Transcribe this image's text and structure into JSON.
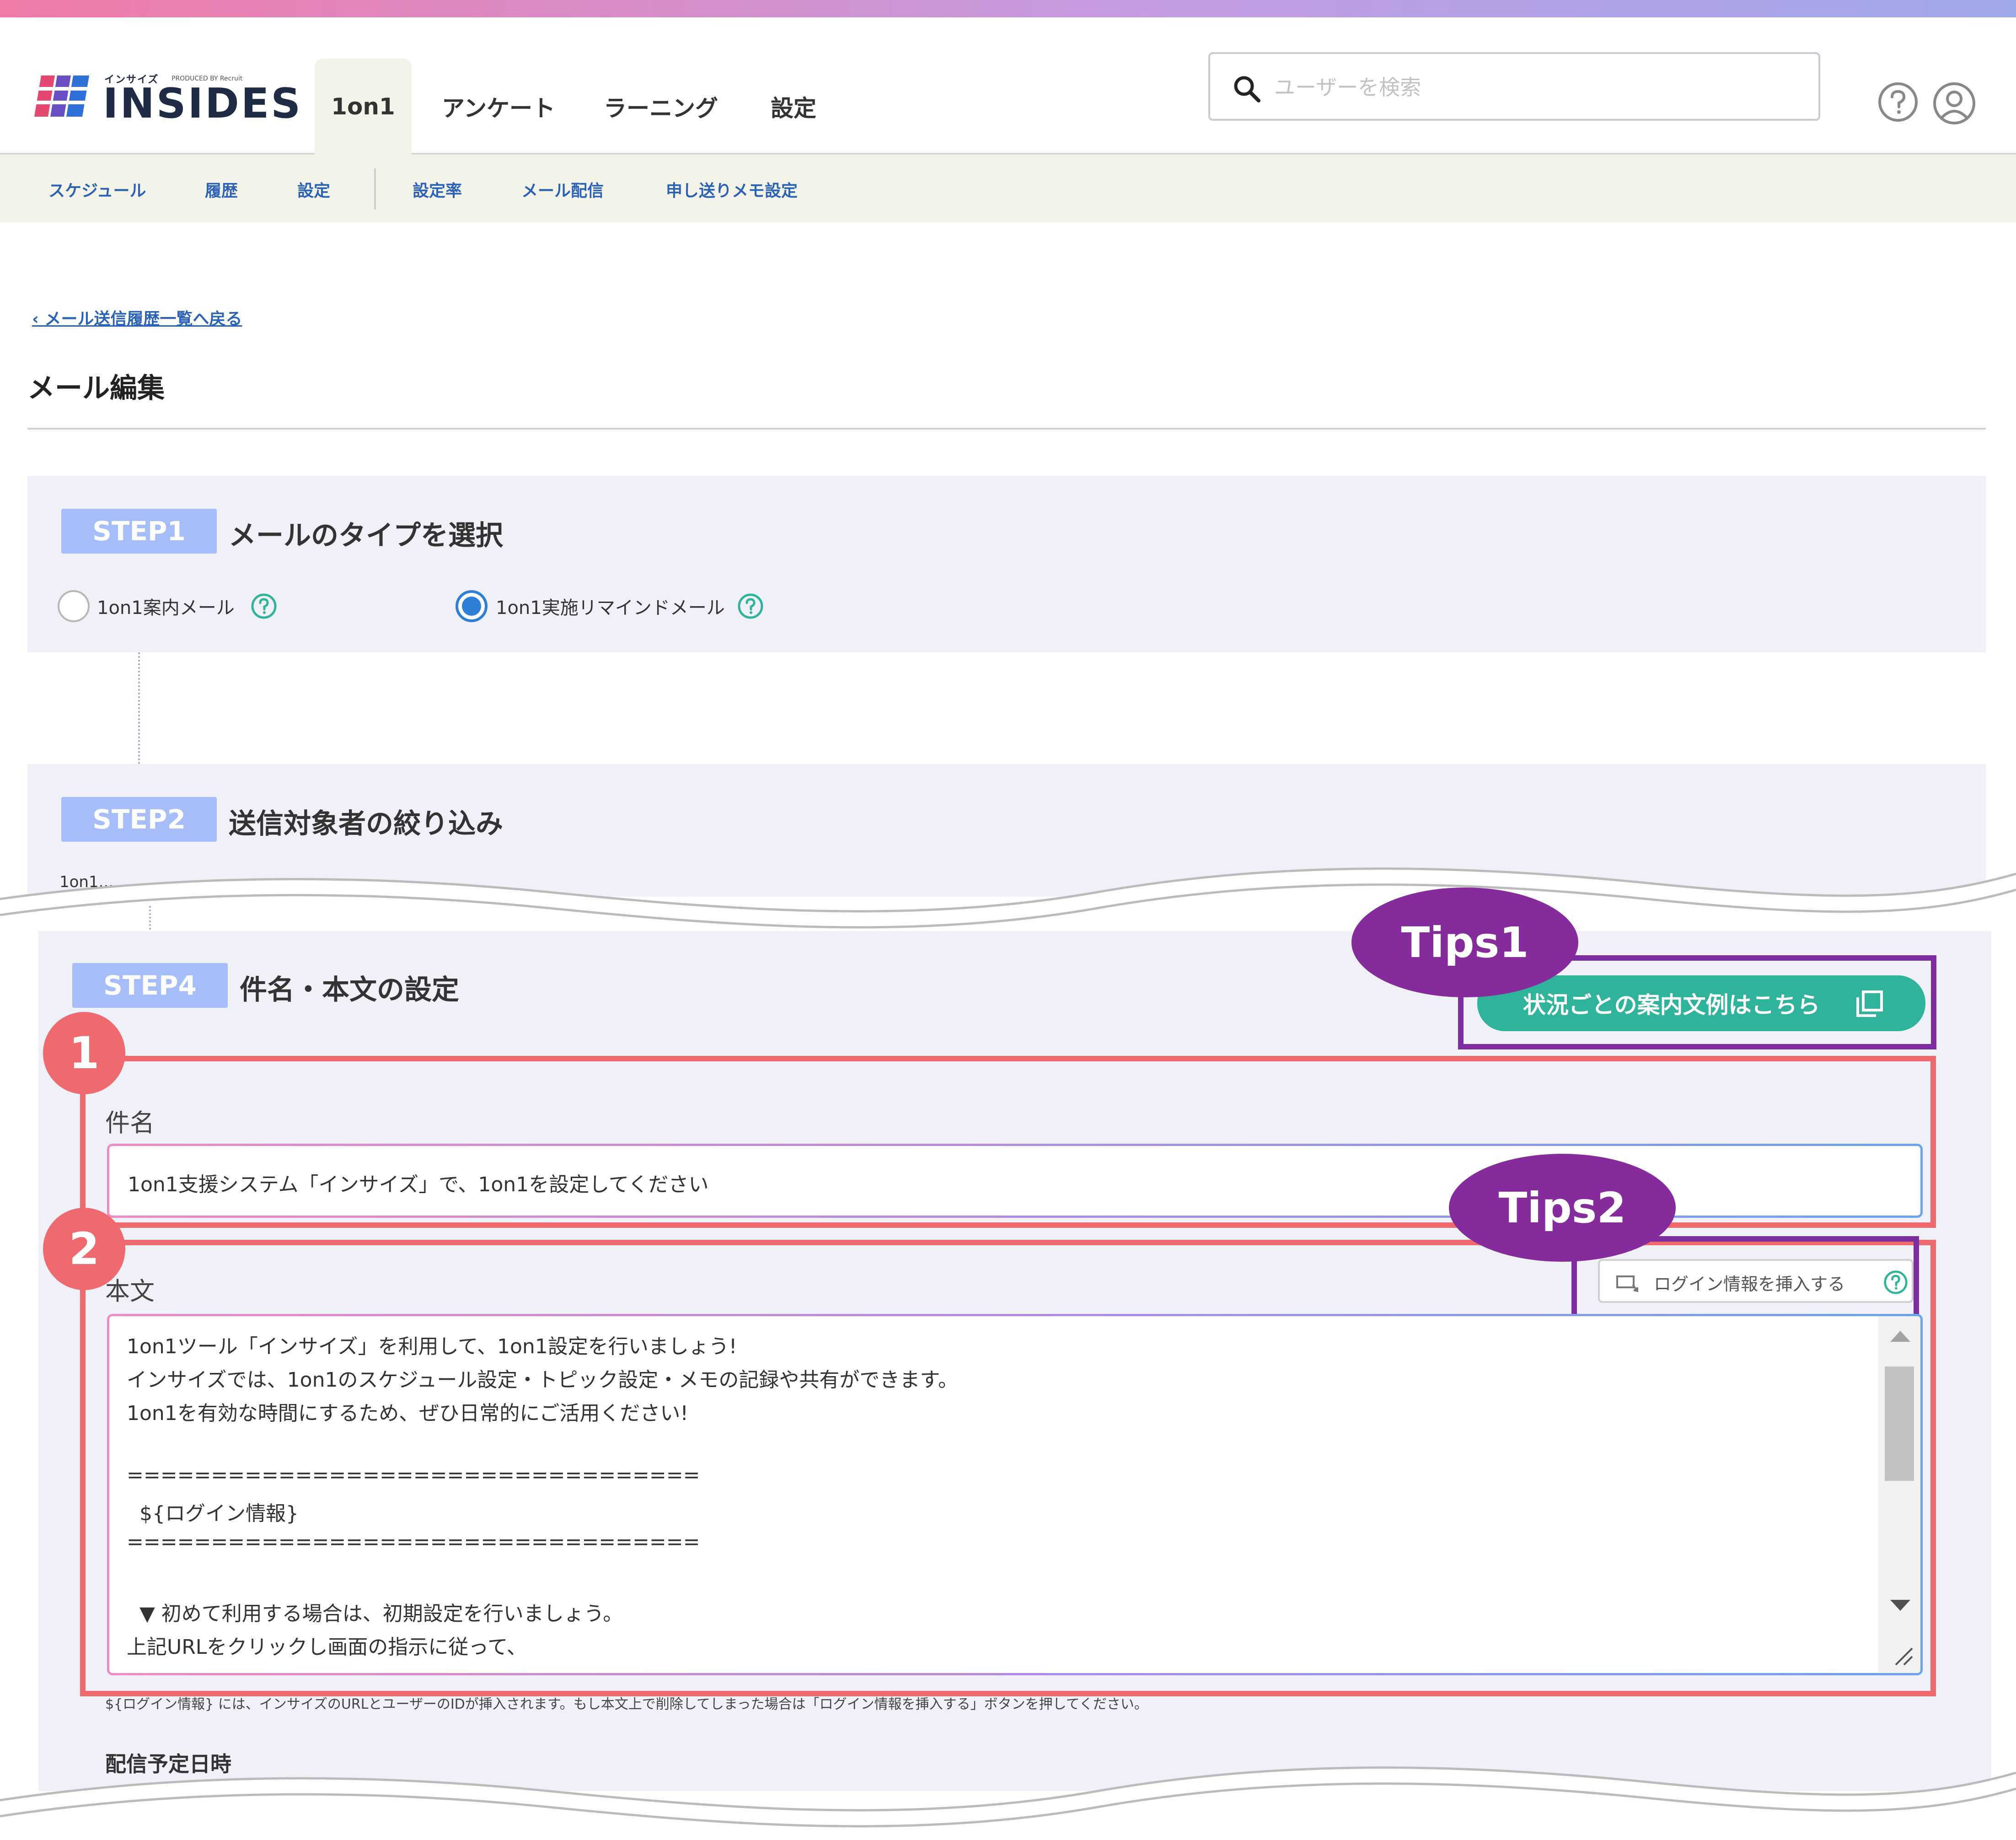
{
  "header": {
    "logo_small": "インサイズ",
    "logo_produced": "PRODUCED BY Recruit",
    "logo_text": "INSIDES",
    "nav_tabs": [
      {
        "label": "1on1"
      },
      {
        "label": "アンケート"
      },
      {
        "label": "ラーニング"
      },
      {
        "label": "設定"
      }
    ],
    "search_placeholder": "ユーザーを検索"
  },
  "subnav": {
    "items": [
      {
        "label": "スケジュール"
      },
      {
        "label": "履歴"
      },
      {
        "label": "設定"
      },
      {
        "label": "設定率"
      },
      {
        "label": "メール配信"
      },
      {
        "label": "申し送りメモ設定"
      }
    ]
  },
  "page": {
    "back_link": "‹ メール送信履歴一覧へ戻る",
    "title": "メール編集"
  },
  "step1": {
    "badge": "STEP1",
    "title": "メールのタイプを選択",
    "options": [
      {
        "label": "1on1案内メール",
        "checked": false
      },
      {
        "label": "1on1実施リマインドメール",
        "checked": true
      }
    ]
  },
  "step2": {
    "badge": "STEP2",
    "title": "送信対象者の絞り込み",
    "cut_text": "1on1..."
  },
  "step4": {
    "badge": "STEP4",
    "title": "件名・本文の設定",
    "examples_button": "状況ごとの案内文例はこちら",
    "subject_label": "件名",
    "subject_value": "1on1支援システム「インサイズ」で、1on1を設定してください",
    "body_label": "本文",
    "login_insert_button": "ログイン情報を挿入する",
    "body_lines": [
      "1on1ツール「インサイズ」を利用して、1on1設定を行いましょう!",
      "インサイズでは、1on1のスケジュール設定・トピック設定・メモの記録や共有ができます。",
      "1on1を有効な時間にするため、ぜひ日常的にご活用ください!",
      "",
      "==================================",
      "  ${ログイン情報}",
      "==================================",
      "",
      "  ▼ 初めて利用する場合は、初期設定を行いましょう。",
      "上記URLをクリックし画面の指示に従って、"
    ],
    "note": "${ログイン情報} には、インサイズのURLとユーザーのIDが挿入されます。もし本文上で削除してしまった場合は「ログイン情報を挿入する」ボタンを押してください。",
    "schedule_label": "配信予定日時"
  },
  "annotations": {
    "tips1": "Tips1",
    "tips2": "Tips2",
    "num1": "1",
    "num2": "2"
  },
  "colors": {
    "accent_blue": "#2a62b8",
    "step_badge": "#a7bdfa",
    "teal_button": "#2fb39a",
    "annotation_purple": "#852b9c",
    "annotation_red": "#ee6a6f"
  }
}
